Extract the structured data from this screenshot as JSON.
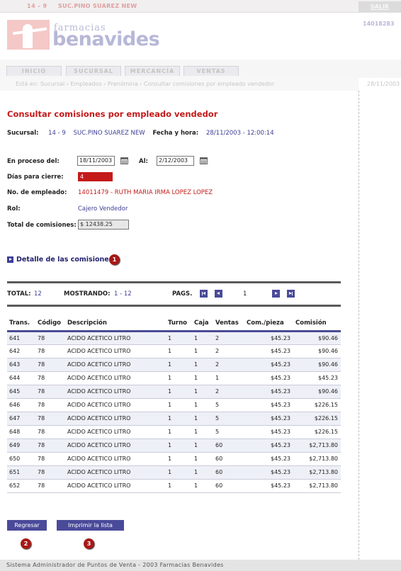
{
  "topbar": {
    "store_code": "14 - 9",
    "store_name": "SUC.PINO SUAREZ NEW",
    "logout_label": "SALIR"
  },
  "logo": {
    "small_text": "farmacias",
    "big_text": "benavides"
  },
  "user_id": "14018283",
  "tabs": [
    {
      "label": "INICIO"
    },
    {
      "label": "SUCURSAL"
    },
    {
      "label": "MERCANCÍA"
    },
    {
      "label": "VENTAS"
    }
  ],
  "breadcrumb": "Está en: Sucursal › Empleados › Prenómina › Consultar comisiones por empleado vendedor",
  "date_top": "28/11/2003",
  "page_title": "Consultar comisiones por empleado vendedor",
  "info": {
    "sucursal_label": "Sucursal:",
    "sucursal_code": "14 - 9",
    "sucursal_name": "SUC.PINO SUAREZ NEW",
    "fecha_label": "Fecha y hora:",
    "fecha_value": "28/11/2003 - 12:00:14"
  },
  "form": {
    "en_proceso_label": "En proceso del:",
    "desde": "18/11/2003",
    "al_label": "Al:",
    "hasta": "2/12/2003",
    "dias_label": "Días para cierre:",
    "dias_value": "4",
    "empleado_label": "No. de empleado:",
    "empleado_value": "14011479 - RUTH MARIA IRMA LOPEZ LOPEZ",
    "rol_label": "Rol:",
    "rol_value": "Cajero Vendedor",
    "total_label": "Total de comisiones:",
    "total_value": "$ 12438.25"
  },
  "detail": {
    "label": "Detalle de las comisiones",
    "badge": "1"
  },
  "pager": {
    "total_label": "TOTAL:",
    "total_value": "12",
    "mostrando_label": "MOSTRANDO:",
    "mostrando_value": "1 - 12",
    "pags_label": "PAGS.",
    "current_page": "1"
  },
  "table": {
    "headers": [
      "Trans.",
      "Código",
      "Descripción",
      "Turno",
      "Caja",
      "Ventas",
      "Com./pieza",
      "Comisión"
    ],
    "rows": [
      [
        "641",
        "78",
        "ACIDO ACETICO LITRO",
        "1",
        "1",
        "2",
        "$45.23",
        "$90.46"
      ],
      [
        "642",
        "78",
        "ACIDO ACETICO LITRO",
        "1",
        "1",
        "2",
        "$45.23",
        "$90.46"
      ],
      [
        "643",
        "78",
        "ACIDO ACETICO LITRO",
        "1",
        "1",
        "2",
        "$45.23",
        "$90.46"
      ],
      [
        "644",
        "78",
        "ACIDO ACETICO LITRO",
        "1",
        "1",
        "1",
        "$45.23",
        "$45.23"
      ],
      [
        "645",
        "78",
        "ACIDO ACETICO LITRO",
        "1",
        "1",
        "2",
        "$45.23",
        "$90.46"
      ],
      [
        "646",
        "78",
        "ACIDO ACETICO LITRO",
        "1",
        "1",
        "5",
        "$45.23",
        "$226.15"
      ],
      [
        "647",
        "78",
        "ACIDO ACETICO LITRO",
        "1",
        "1",
        "5",
        "$45.23",
        "$226.15"
      ],
      [
        "648",
        "78",
        "ACIDO ACETICO LITRO",
        "1",
        "1",
        "5",
        "$45.23",
        "$226.15"
      ],
      [
        "649",
        "78",
        "ACIDO ACETICO LITRO",
        "1",
        "1",
        "60",
        "$45.23",
        "$2,713.80"
      ],
      [
        "650",
        "78",
        "ACIDO ACETICO LITRO",
        "1",
        "1",
        "60",
        "$45.23",
        "$2,713.80"
      ],
      [
        "651",
        "78",
        "ACIDO ACETICO LITRO",
        "1",
        "1",
        "60",
        "$45.23",
        "$2,713.80"
      ],
      [
        "652",
        "78",
        "ACIDO ACETICO LITRO",
        "1",
        "1",
        "60",
        "$45.23",
        "$2,713.80"
      ]
    ]
  },
  "buttons": {
    "regresar": "Regresar",
    "imprimir": "Imprimir la lista",
    "badge2": "2",
    "badge3": "3"
  },
  "footer": "Sistema Administrador de Puntos de Venta - 2003 Farmacias Benavides",
  "colors": {
    "accent_red": "#c41a1a",
    "accent_blue": "#3d3d96",
    "button_blue": "#4a4a9a"
  }
}
